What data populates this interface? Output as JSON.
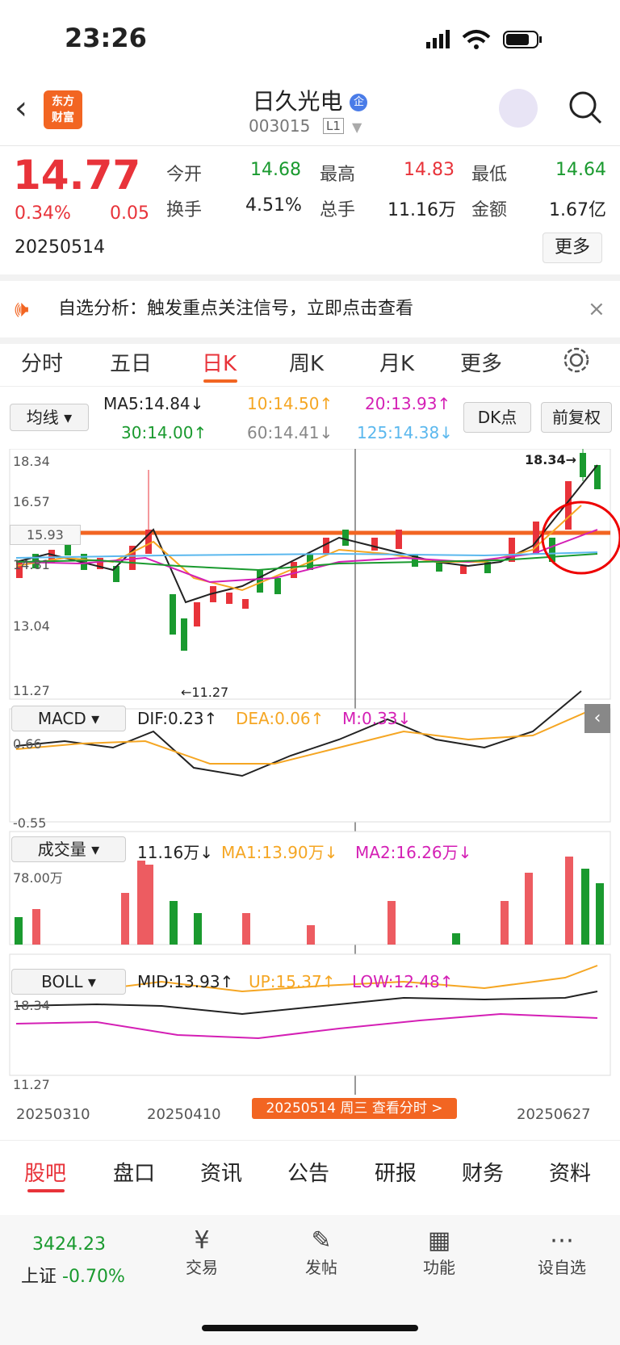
{
  "status": {
    "time": "23:26"
  },
  "header": {
    "logo_text": "东方\n财富",
    "name": "日久光电",
    "badge": "企",
    "code": "003015",
    "level": "L1"
  },
  "quote": {
    "price": "14.77",
    "change_pct": "0.34%",
    "change": "0.05",
    "date": "20250514",
    "open_label": "今开",
    "open": "14.68",
    "high_label": "最高",
    "high": "14.83",
    "low_label": "最低",
    "low": "14.64",
    "turnover_label": "换手",
    "turnover": "4.51%",
    "volume_label": "总手",
    "volume": "11.16万",
    "amount_label": "金额",
    "amount": "1.67亿",
    "more": "更多"
  },
  "notice": {
    "text": "自选分析：触发重点关注信号，立即点击查看",
    "close": "×"
  },
  "tabs": [
    "分时",
    "五日",
    "日K",
    "周K",
    "月K",
    "更多"
  ],
  "ma": {
    "select": "均线",
    "ma5": "MA5:14.84↓",
    "ma10": "10:14.50↑",
    "ma20": "20:13.93↑",
    "ma30": "30:14.00↑",
    "ma60": "60:14.41↓",
    "ma125": "125:14.38↓",
    "dk": "DK点",
    "fq": "前复权"
  },
  "kline": {
    "y_labels": [
      "18.34",
      "16.57",
      "15.93",
      "14.81",
      "13.04",
      "11.27"
    ],
    "max_label": "18.34→",
    "min_label": "←11.27"
  },
  "macd": {
    "select": "MACD",
    "dif": "DIF:0.23↑",
    "dea": "DEA:0.06↑",
    "m": "M:0.33↓",
    "ymax": "0.66",
    "ymin": "-0.55"
  },
  "vol": {
    "select": "成交量",
    "v": "11.16万↓",
    "ma1": "MA1:13.90万↓",
    "ma2": "MA2:16.26万↓",
    "ymax": "78.00万"
  },
  "boll": {
    "select": "BOLL",
    "mid": "MID:13.93↑",
    "up": "UP:15.37↑",
    "low": "LOW:12.48↑",
    "ymax": "18.34",
    "ymin": "11.27"
  },
  "xaxis": {
    "d1": "20250310",
    "d2": "20250410",
    "d3": "20250627",
    "tip": "20250514 周三 查看分时 >"
  },
  "panel_tabs": [
    "股吧",
    "盘口",
    "资讯",
    "公告",
    "研报",
    "财务",
    "资料"
  ],
  "bottom": {
    "index_value": "3424.23",
    "index_name": "上证",
    "index_change": "-0.70%",
    "trade": "交易",
    "post": "发帖",
    "func": "功能",
    "watch": "设自选"
  },
  "colors": {
    "up": "#e8333a",
    "down": "#1a9a2f",
    "accent": "#f26522"
  }
}
